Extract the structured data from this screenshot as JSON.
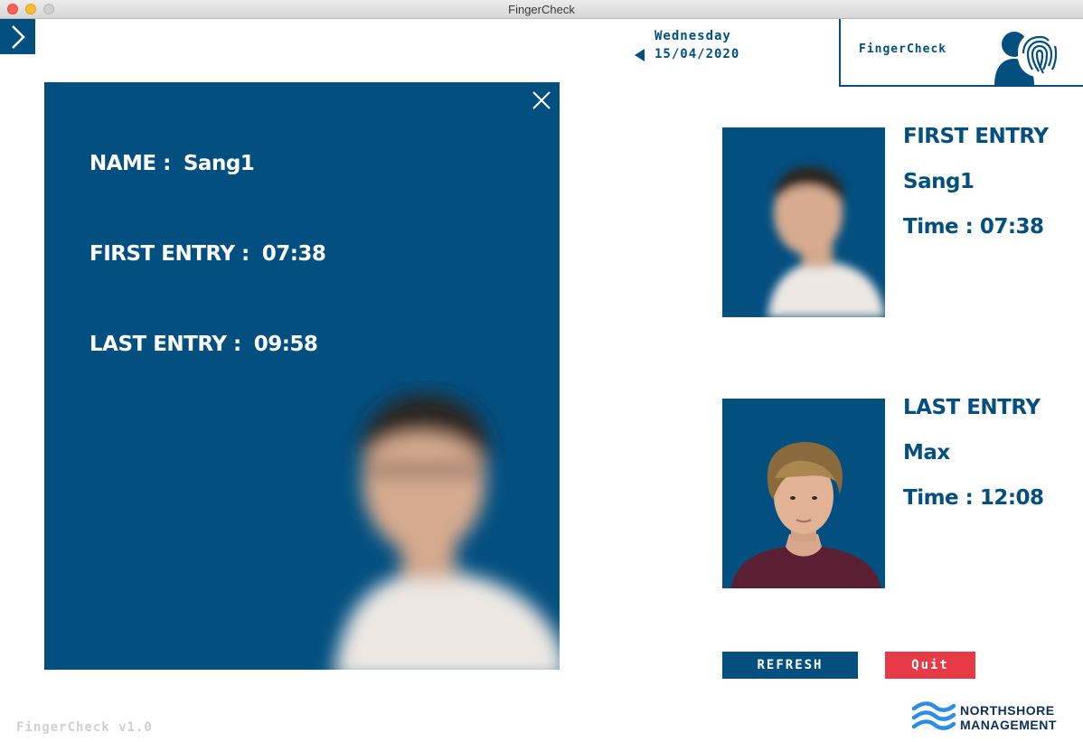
{
  "window": {
    "title": "FingerCheck"
  },
  "header": {
    "day": "Wednesday",
    "date": "15/04/2020",
    "app_name": "FingerCheck"
  },
  "detail": {
    "name_label": "NAME :",
    "name_value": "Sang1",
    "first_label": "FIRST ENTRY :",
    "first_value": "07:38",
    "last_label": "LAST ENTRY :",
    "last_value": "09:58"
  },
  "first_entry": {
    "heading": "FIRST ENTRY",
    "name": "Sang1",
    "time": "Time : 07:38"
  },
  "last_entry": {
    "heading": "LAST ENTRY",
    "name": "Max",
    "time": "Time : 12:08"
  },
  "buttons": {
    "refresh": "REFRESH",
    "quit": "Quit"
  },
  "footer": {
    "version": "FingerCheck v1.0",
    "brand_line1": "NORTHSHORE",
    "brand_line2": "MANAGEMENT"
  },
  "colors": {
    "primary": "#034f80",
    "danger": "#e63a46",
    "brand_wave": "#2a8de8"
  }
}
